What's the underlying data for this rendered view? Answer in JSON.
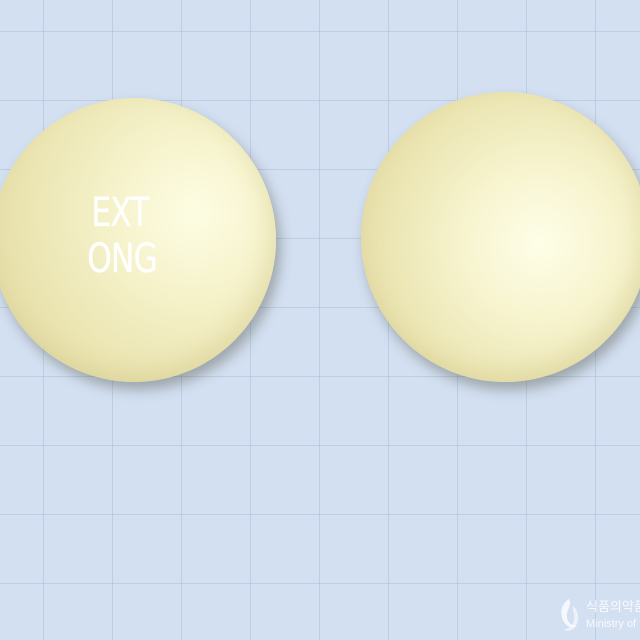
{
  "tablets": [
    {
      "side": "left",
      "color": "#f3efc4",
      "imprint_lines": [
        "EXT",
        "ONG"
      ]
    },
    {
      "side": "right",
      "color": "#f3efc4",
      "imprint_lines": []
    }
  ],
  "background": {
    "color": "#d3e0f2",
    "grid_color": "#aabedc"
  },
  "watermark": {
    "korean": "식품의약품",
    "english": "Ministry of Food"
  }
}
